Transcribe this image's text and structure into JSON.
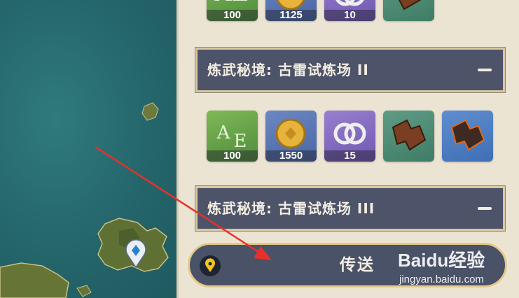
{
  "rewards_top": [
    {
      "icon": "exp-book-icon",
      "bg": "bg-green",
      "count": "100"
    },
    {
      "icon": "mora-coin-icon",
      "bg": "bg-blue",
      "count": "1125"
    },
    {
      "icon": "companionship-exp-icon",
      "bg": "bg-purple",
      "count": "10"
    },
    {
      "icon": "weapon-material-icon",
      "bg": "bg-teal",
      "count": ""
    }
  ],
  "domain_2": {
    "title": "炼武秘境: 古雷试炼场 II",
    "rewards": [
      {
        "icon": "exp-book-icon",
        "bg": "bg-green",
        "count": "100"
      },
      {
        "icon": "mora-coin-icon",
        "bg": "bg-blue",
        "count": "1550"
      },
      {
        "icon": "companionship-exp-icon",
        "bg": "bg-purple",
        "count": "15"
      },
      {
        "icon": "weapon-material-icon",
        "bg": "bg-teal",
        "count": ""
      },
      {
        "icon": "weapon-material-rare-icon",
        "bg": "bg-sky",
        "count": ""
      }
    ]
  },
  "domain_3": {
    "title": "炼武秘境: 古雷试炼场 III"
  },
  "teleport": {
    "label": "传送"
  },
  "watermark": {
    "brand": "Baidu经验",
    "url": "jingyan.baidu.com"
  },
  "colors": {
    "header": "#4d5368",
    "panel": "#ece4d2",
    "accent": "#e3c88d",
    "pin": "#f2c61b",
    "arrow": "#e8302b"
  }
}
